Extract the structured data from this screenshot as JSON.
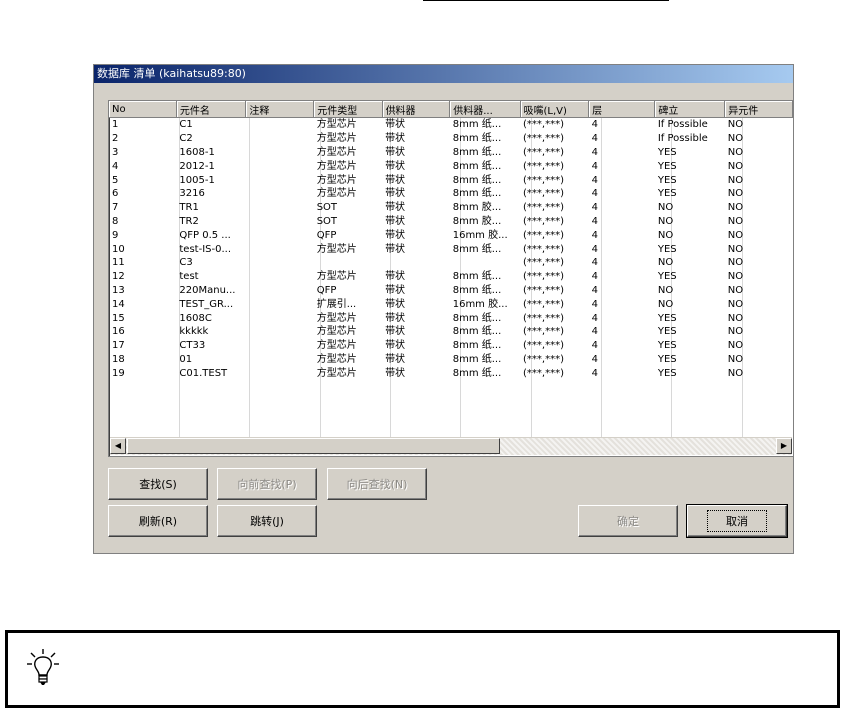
{
  "window": {
    "title": "数据库 清单 (kaihatsu89:80)"
  },
  "table": {
    "columns": [
      "No",
      "元件名",
      "注释",
      "元件类型",
      "供料器",
      "供料器...",
      "吸嘴(L,V)",
      "层",
      "碑立",
      "异元件"
    ],
    "rows": [
      [
        "1",
        "C1",
        "",
        "方型芯片",
        "带状",
        "8mm 纸...",
        "(***,***)",
        "4",
        "If Possible",
        "NO"
      ],
      [
        "2",
        "C2",
        "",
        "方型芯片",
        "带状",
        "8mm 纸...",
        "(***,***)",
        "4",
        "If Possible",
        "NO"
      ],
      [
        "3",
        "1608-1",
        "",
        "方型芯片",
        "带状",
        "8mm 纸...",
        "(***,***)",
        "4",
        "YES",
        "NO"
      ],
      [
        "4",
        "2012-1",
        "",
        "方型芯片",
        "带状",
        "8mm 纸...",
        "(***,***)",
        "4",
        "YES",
        "NO"
      ],
      [
        "5",
        "1005-1",
        "",
        "方型芯片",
        "带状",
        "8mm 纸...",
        "(***,***)",
        "4",
        "YES",
        "NO"
      ],
      [
        "6",
        "3216",
        "",
        "方型芯片",
        "带状",
        "8mm 纸...",
        "(***,***)",
        "4",
        "YES",
        "NO"
      ],
      [
        "7",
        "TR1",
        "",
        "SOT",
        "带状",
        "8mm 胶...",
        "(***,***)",
        "4",
        "NO",
        "NO"
      ],
      [
        "8",
        "TR2",
        "",
        "SOT",
        "带状",
        "8mm 胶...",
        "(***,***)",
        "4",
        "NO",
        "NO"
      ],
      [
        "9",
        "QFP 0.5 ...",
        "",
        "QFP",
        "带状",
        "16mm 胶...",
        "(***,***)",
        "4",
        "NO",
        "NO"
      ],
      [
        "10",
        "test-IS-0...",
        "",
        "方型芯片",
        "带状",
        "8mm 纸...",
        "(***,***)",
        "4",
        "YES",
        "NO"
      ],
      [
        "11",
        "C3",
        "",
        "",
        "",
        "",
        "(***,***)",
        "4",
        "NO",
        "NO"
      ],
      [
        "12",
        "test",
        "",
        "方型芯片",
        "带状",
        "8mm 纸...",
        "(***,***)",
        "4",
        "YES",
        "NO"
      ],
      [
        "13",
        "220Manu...",
        "",
        "QFP",
        "带状",
        "8mm 纸...",
        "(***,***)",
        "4",
        "NO",
        "NO"
      ],
      [
        "14",
        "TEST_GR...",
        "",
        "扩展引...",
        "带状",
        "16mm 胶...",
        "(***,***)",
        "4",
        "NO",
        "NO"
      ],
      [
        "15",
        "1608C",
        "",
        "方型芯片",
        "带状",
        "8mm 纸...",
        "(***,***)",
        "4",
        "YES",
        "NO"
      ],
      [
        "16",
        "kkkkk",
        "",
        "方型芯片",
        "带状",
        "8mm 纸...",
        "(***,***)",
        "4",
        "YES",
        "NO"
      ],
      [
        "17",
        "CT33",
        "",
        "方型芯片",
        "带状",
        "8mm 纸...",
        "(***,***)",
        "4",
        "YES",
        "NO"
      ],
      [
        "18",
        "01",
        "",
        "方型芯片",
        "带状",
        "8mm 纸...",
        "(***,***)",
        "4",
        "YES",
        "NO"
      ],
      [
        "19",
        "C01.TEST",
        "",
        "方型芯片",
        "带状",
        "8mm 纸...",
        "(***,***)",
        "4",
        "YES",
        "NO"
      ]
    ]
  },
  "scrollbar": {
    "left_arrow": "◀",
    "right_arrow": "▶"
  },
  "buttons": {
    "find": "查找(S)",
    "find_prev": "向前查找(P)",
    "find_next": "向后查找(N)",
    "refresh": "刷新(R)",
    "jump": "跳转(J)",
    "ok": "确定",
    "cancel": "取消"
  },
  "tip": {
    "icon": "lightbulb-icon"
  }
}
